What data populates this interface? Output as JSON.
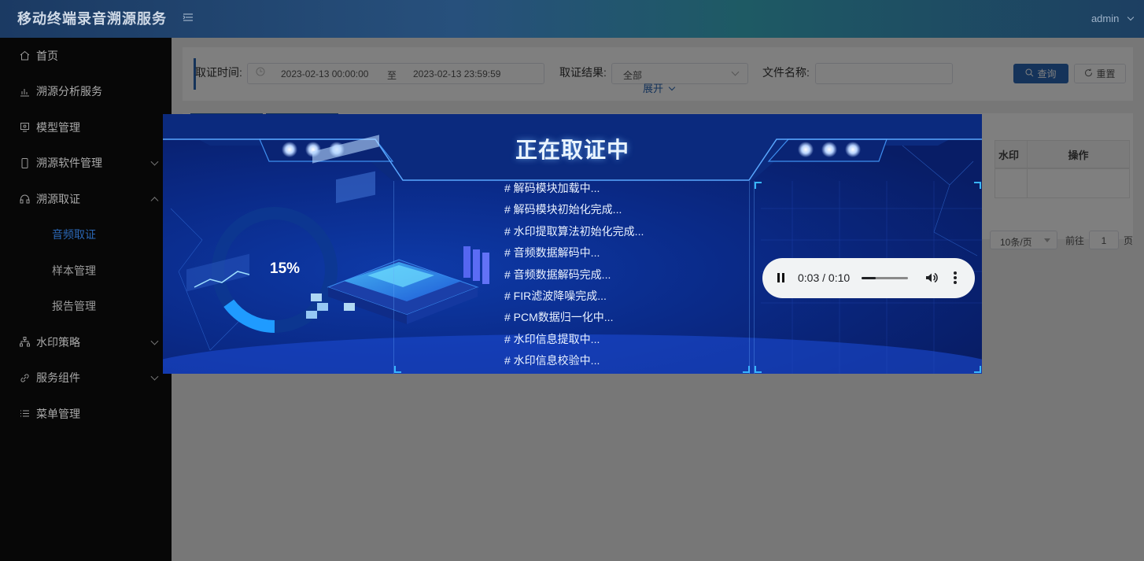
{
  "app": {
    "title": "移动终端录音溯源服务",
    "user": "admin"
  },
  "sidebar": {
    "items": [
      {
        "label": "首页",
        "icon": "home-icon"
      },
      {
        "label": "溯源分析服务",
        "icon": "chart-icon"
      },
      {
        "label": "模型管理",
        "icon": "monitor-icon"
      },
      {
        "label": "溯源软件管理",
        "icon": "phone-icon"
      },
      {
        "label": "溯源取证",
        "icon": "headphones-icon"
      },
      {
        "label": "音频取证",
        "icon": ""
      },
      {
        "label": "样本管理",
        "icon": ""
      },
      {
        "label": "报告管理",
        "icon": ""
      },
      {
        "label": "水印策略",
        "icon": "sitemap-icon"
      },
      {
        "label": "服务组件",
        "icon": "link-icon"
      },
      {
        "label": "菜单管理",
        "icon": "list-icon"
      }
    ]
  },
  "filter": {
    "time_label": "取证时间:",
    "start_time": "2023-02-13 00:00:00",
    "range_sep": "至",
    "end_time": "2023-02-13 23:59:59",
    "result_label": "取证结果:",
    "result_value": "全部",
    "filename_label": "文件名称:",
    "filename_value": "",
    "search_button": "查询",
    "reset_button": "重置",
    "expand": "展开"
  },
  "table": {
    "headers": [
      "水印",
      "操作"
    ]
  },
  "pagination": {
    "page_size": "10条/页",
    "goto_label": "前往",
    "page": "1",
    "page_unit": "页"
  },
  "dialog": {
    "title": "正在取证中",
    "percent_text": "15%",
    "progress": 0.15,
    "log": [
      "# 解码模块加载中...",
      "# 解码模块初始化完成...",
      "# 水印提取算法初始化完成...",
      "# 音频数据解码中...",
      "# 音频数据解码完成...",
      "# FIR滤波降噪完成...",
      "# PCM数据归一化中...",
      "# 水印信息提取中...",
      "# 水印信息校验中..."
    ]
  },
  "audio": {
    "time_display": "0:03 / 0:10",
    "progress": 0.3
  },
  "colors": {
    "primary": "#2b67b5",
    "sidebar_bg": "#070707",
    "dialog_bg": "#0a2a88"
  }
}
